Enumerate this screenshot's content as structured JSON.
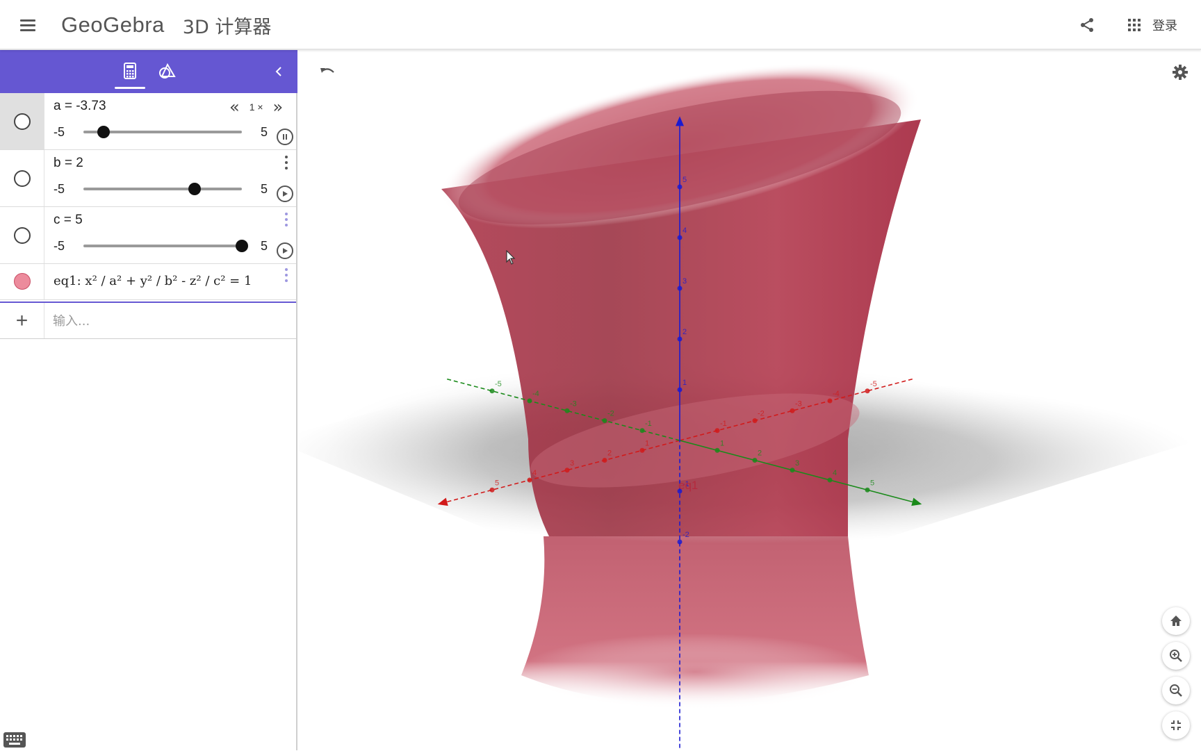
{
  "app": {
    "logo": "GeoGebra",
    "subtitle": "3D 计算器"
  },
  "header": {
    "login_label": "登录"
  },
  "algebra": {
    "sliders": [
      {
        "definition": "a = -3.73",
        "min": "-5",
        "max": "5",
        "value": -3.73,
        "playing": true,
        "speed": "1 ×"
      },
      {
        "definition": "b = 2",
        "min": "-5",
        "max": "5",
        "value": 2,
        "playing": false
      },
      {
        "definition": "c = 5",
        "min": "-5",
        "max": "5",
        "value": 5,
        "playing": false
      }
    ],
    "equation": {
      "text": "eq1: x² / a² + y² / b² - z² / c² = 1"
    },
    "input_placeholder": "输入..."
  },
  "graphics": {
    "surface_label": "eq1",
    "z_ticks": [
      "5",
      "4",
      "3",
      "2",
      "1",
      "-1",
      "-2"
    ],
    "x_ticks": [
      "-5",
      "-4",
      "-3",
      "-2",
      "-1",
      "1",
      "2",
      "3",
      "4",
      "5"
    ],
    "y_ticks": [
      "-5",
      "-4",
      "-3",
      "-2",
      "-1",
      "1",
      "2",
      "3",
      "4",
      "5"
    ]
  },
  "colors": {
    "toolbar": "#6557d2",
    "surface": "#b23a4e",
    "x_axis": "#d11a1a",
    "y_axis": "#1a8a1a",
    "z_axis": "#1a1ad1"
  },
  "icons": {
    "menu": "hamburger-icon",
    "share": "share-icon",
    "apps": "apps-grid-icon",
    "algebra_tab": "calculator-icon",
    "tools_tab": "geometry-tools-icon",
    "undo": "undo-icon",
    "settings": "gear-icon",
    "home": "home-icon",
    "zoom_in": "zoom-in-icon",
    "zoom_out": "zoom-out-icon",
    "fullscreen": "exit-fullscreen-icon",
    "keyboard": "keyboard-icon",
    "cursor": "mouse-pointer-icon"
  }
}
